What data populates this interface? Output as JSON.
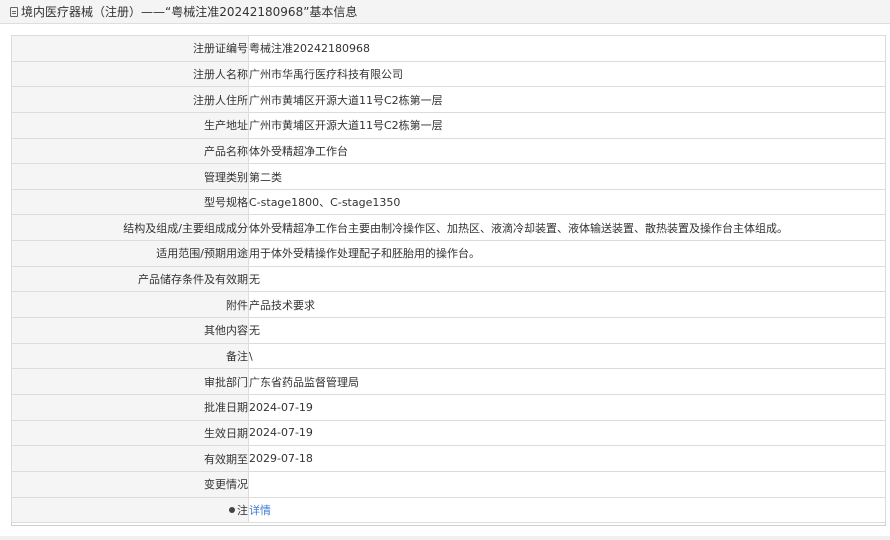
{
  "header": {
    "title": "境内医疗器械（注册）——“粤械注准20242180968”基本信息"
  },
  "rows": [
    {
      "label": "注册证编号",
      "value": "粤械注准20242180968"
    },
    {
      "label": "注册人名称",
      "value": "广州市华禹行医疗科技有限公司"
    },
    {
      "label": "注册人住所",
      "value": "广州市黄埔区开源大道11号C2栋第一层"
    },
    {
      "label": "生产地址",
      "value": "广州市黄埔区开源大道11号C2栋第一层"
    },
    {
      "label": "产品名称",
      "value": "体外受精超净工作台"
    },
    {
      "label": "管理类别",
      "value": "第二类"
    },
    {
      "label": "型号规格",
      "value": "C-stage1800、C-stage1350"
    },
    {
      "label": "结构及组成/主要组成成分",
      "value": "体外受精超净工作台主要由制冷操作区、加热区、液滴冷却装置、液体输送装置、散热装置及操作台主体组成。"
    },
    {
      "label": "适用范围/预期用途",
      "value": "用于体外受精操作处理配子和胚胎用的操作台。"
    },
    {
      "label": "产品储存条件及有效期",
      "value": "无"
    },
    {
      "label": "附件",
      "value": "产品技术要求"
    },
    {
      "label": "其他内容",
      "value": "无"
    },
    {
      "label": "备注",
      "value": "\\"
    },
    {
      "label": "审批部门",
      "value": "广东省药品监督管理局"
    },
    {
      "label": "批准日期",
      "value": "2024-07-19"
    },
    {
      "label": "生效日期",
      "value": "2024-07-19"
    },
    {
      "label": "有效期至",
      "value": "2029-07-18"
    },
    {
      "label": "变更情况",
      "value": ""
    }
  ],
  "note": {
    "label": "注",
    "link": "详情"
  },
  "colors": {
    "label_bg": "#f5f5f5",
    "border": "#dcdcdc",
    "link": "#3a7bd5"
  }
}
